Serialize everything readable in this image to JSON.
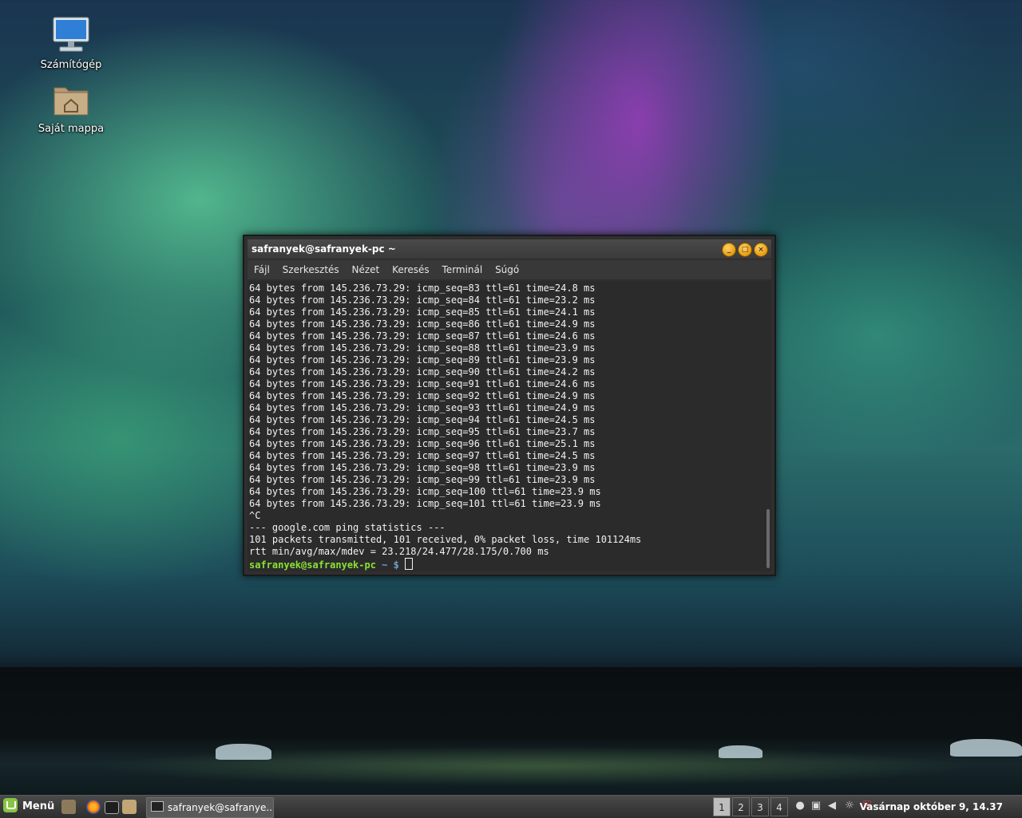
{
  "desktop": {
    "icons": [
      {
        "label": "Számítógép",
        "icon": "computer-icon"
      },
      {
        "label": "Saját mappa",
        "icon": "home-folder-icon"
      }
    ]
  },
  "terminal": {
    "title": "safranyek@safranyek-pc ~",
    "menu": [
      "Fájl",
      "Szerkesztés",
      "Nézet",
      "Keresés",
      "Terminál",
      "Súgó"
    ],
    "lines": [
      "64 bytes from 145.236.73.29: icmp_seq=83 ttl=61 time=24.8 ms",
      "64 bytes from 145.236.73.29: icmp_seq=84 ttl=61 time=23.2 ms",
      "64 bytes from 145.236.73.29: icmp_seq=85 ttl=61 time=24.1 ms",
      "64 bytes from 145.236.73.29: icmp_seq=86 ttl=61 time=24.9 ms",
      "64 bytes from 145.236.73.29: icmp_seq=87 ttl=61 time=24.6 ms",
      "64 bytes from 145.236.73.29: icmp_seq=88 ttl=61 time=23.9 ms",
      "64 bytes from 145.236.73.29: icmp_seq=89 ttl=61 time=23.9 ms",
      "64 bytes from 145.236.73.29: icmp_seq=90 ttl=61 time=24.2 ms",
      "64 bytes from 145.236.73.29: icmp_seq=91 ttl=61 time=24.6 ms",
      "64 bytes from 145.236.73.29: icmp_seq=92 ttl=61 time=24.9 ms",
      "64 bytes from 145.236.73.29: icmp_seq=93 ttl=61 time=24.9 ms",
      "64 bytes from 145.236.73.29: icmp_seq=94 ttl=61 time=24.5 ms",
      "64 bytes from 145.236.73.29: icmp_seq=95 ttl=61 time=23.7 ms",
      "64 bytes from 145.236.73.29: icmp_seq=96 ttl=61 time=25.1 ms",
      "64 bytes from 145.236.73.29: icmp_seq=97 ttl=61 time=24.5 ms",
      "64 bytes from 145.236.73.29: icmp_seq=98 ttl=61 time=23.9 ms",
      "64 bytes from 145.236.73.29: icmp_seq=99 ttl=61 time=23.9 ms",
      "64 bytes from 145.236.73.29: icmp_seq=100 ttl=61 time=23.9 ms",
      "64 bytes from 145.236.73.29: icmp_seq=101 ttl=61 time=23.9 ms",
      "^C",
      "--- google.com ping statistics ---",
      "101 packets transmitted, 101 received, 0% packet loss, time 101124ms",
      "rtt min/avg/max/mdev = 23.218/24.477/28.175/0.700 ms"
    ],
    "prompt": {
      "user_host": "safranyek@safranyek-pc",
      "path": " ~ $ "
    },
    "colors": {
      "prompt_user": "#8ae234",
      "prompt_path": "#729fcf",
      "button": "#e59a10"
    }
  },
  "taskbar": {
    "menu_label": "Menü",
    "task_label": "safranyek@safranye...",
    "workspaces": [
      "1",
      "2",
      "3",
      "4"
    ],
    "active_workspace": "1",
    "clock": "Vasárnap október  9, 14.37"
  }
}
